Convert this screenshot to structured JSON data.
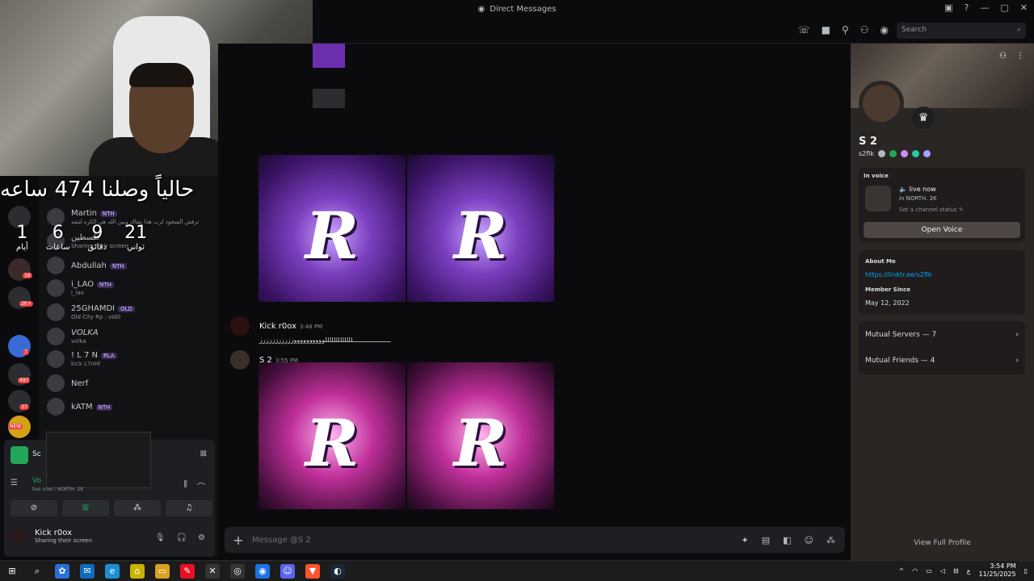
{
  "window": {
    "title": "Direct Messages"
  },
  "header": {
    "search_placeholder": "Search"
  },
  "overlay": {
    "banner": "حالياً وصلنا 474 ساعه",
    "countdown": [
      {
        "num": "1",
        "label": "أيام"
      },
      {
        "num": "6",
        "label": "ساعات"
      },
      {
        "num": "9",
        "label": "دقائق"
      },
      {
        "num": "21",
        "label": "ثواني"
      }
    ]
  },
  "guild_badges": {
    "b1": "18",
    "b2": "2K+",
    "b3": "7",
    "b4": "497",
    "b5": "37",
    "new": "NEW"
  },
  "dms": [
    {
      "name": "Martin",
      "tag": "NTH",
      "sub": "ترفض السجود لرب هذا بتقاك وبين الله هي الكزه لتنقه"
    },
    {
      "name": "فلسطين",
      "tag": "",
      "sub": "Sharing their screen"
    },
    {
      "name": "Abdullah",
      "tag": "NTH",
      "sub": ""
    },
    {
      "name": "i_LAO",
      "tag": "NTH",
      "sub": "i_lao"
    },
    {
      "name": "25GHAMDI",
      "tag": "OLD",
      "sub": "Old City Rp : old0"
    },
    {
      "name": "VOLKA",
      "tag": "",
      "sub": "volka"
    },
    {
      "name": "! L 7 N",
      "tag": "RLA",
      "sub": "kick L7nHl"
    },
    {
      "name": "Nerf",
      "tag": "",
      "sub": ""
    },
    {
      "name": "kATM",
      "tag": "NTH",
      "sub": ""
    }
  ],
  "messages": [
    {
      "author": "Kick r0ox",
      "time": "3:48 PM",
      "body": "ــــــــــــــــــــلللللللللللللووووووووووززززززززززز"
    },
    {
      "author": "S 2",
      "time": "3:55 PM",
      "body": ""
    }
  ],
  "composer": {
    "placeholder": "Message @S 2"
  },
  "profile": {
    "display_name": "S 2",
    "username": "s2flk",
    "in_voice_label": "In voice",
    "live_now": "live now",
    "in_server": "in NORTH. 2K",
    "channel_status": "Set a channel status",
    "open_voice": "Open Voice",
    "about_me_label": "About Me",
    "about_me_link": "https://linktr.ee/s2flk",
    "member_since_label": "Member Since",
    "member_since": "May 12, 2022",
    "mutual_servers": "Mutual Servers — 7",
    "mutual_friends": "Mutual Friends — 4",
    "view_full": "View Full Profile"
  },
  "userpanel": {
    "sc_label": "Sc",
    "voice_label": "Vo",
    "voice_sub": "live now / NORTH. 2K",
    "self_name": "Kick r0ox",
    "self_status": "Sharing their screen"
  },
  "taskbar": {
    "time": "3:54 PM",
    "date": "11/25/2025",
    "lang": "ع"
  }
}
